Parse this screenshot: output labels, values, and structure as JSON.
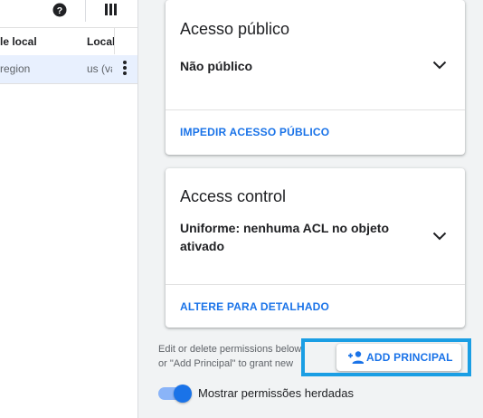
{
  "table": {
    "header_col1": "le local",
    "header_col2": "Local",
    "row_col1": "region",
    "row_col2": "us (va"
  },
  "public_access_card": {
    "title": "Acesso público",
    "value": "Não público",
    "action": "IMPEDIR ACESSO PÚBLICO"
  },
  "access_control_card": {
    "title": "Access control",
    "value": "Uniforme: nenhuma ACL no objeto ativado",
    "action": "ALTERE PARA DETALHADO"
  },
  "permissions": {
    "helper_line1": "Edit or delete permissions below",
    "helper_line2": "or \"Add Principal\" to grant new",
    "add_button_label": "ADD PRINCIPAL",
    "toggle_label": "Mostrar permissões herdadas",
    "toggle_on": true
  },
  "colors": {
    "accent": "#1a73e8",
    "highlight": "#1a9ee4",
    "selected_row": "#e8f0fe"
  },
  "icons": [
    "help-icon",
    "columns-icon",
    "more-vert-icon",
    "chevron-down-icon",
    "person-add-icon"
  ]
}
